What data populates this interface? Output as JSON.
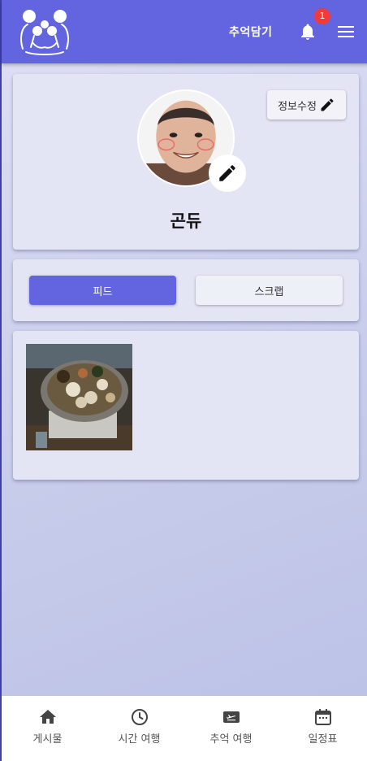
{
  "appbar": {
    "link_label": "추억담기",
    "notification_count": "1",
    "colors": {
      "primary": "#6264e0",
      "badge": "#ef3b3b"
    }
  },
  "profile": {
    "edit_info_label": "정보수정",
    "username": "곤듀"
  },
  "tabs": [
    {
      "label": "피드",
      "active": true
    },
    {
      "label": "스크랩",
      "active": false
    }
  ],
  "feed": {
    "items": [
      {
        "kind": "photo",
        "subject": "hot pot food photo"
      }
    ]
  },
  "bottom_nav": [
    {
      "label": "게시물",
      "icon": "home-icon"
    },
    {
      "label": "시간 여행",
      "icon": "clock-icon"
    },
    {
      "label": "추억 여행",
      "icon": "flight-ticket-icon"
    },
    {
      "label": "일정표",
      "icon": "calendar-icon"
    }
  ]
}
